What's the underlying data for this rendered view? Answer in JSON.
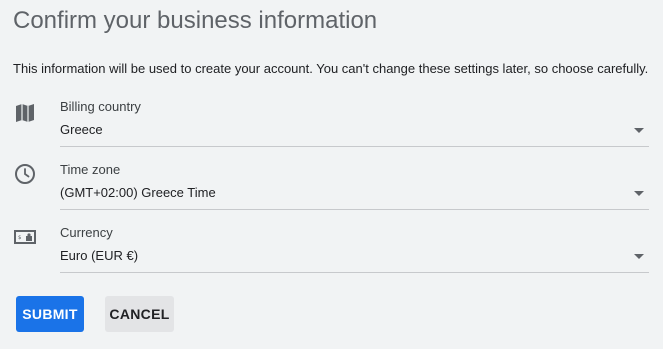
{
  "page": {
    "title": "Confirm your business information",
    "description": "This information will be used to create your account. You can't change these settings later, so choose carefully."
  },
  "fields": [
    {
      "icon": "map-icon",
      "label": "Billing country",
      "value": "Greece"
    },
    {
      "icon": "clock-icon",
      "label": "Time zone",
      "value": "(GMT+02:00) Greece Time"
    },
    {
      "icon": "currency-icon",
      "label": "Currency",
      "value": "Euro (EUR €)"
    }
  ],
  "actions": {
    "submit_label": "SUBMIT",
    "cancel_label": "CANCEL"
  },
  "colors": {
    "primary": "#1a73e8",
    "background": "#f1f3f4",
    "title": "#5f6368",
    "icon": "#5f6368"
  }
}
